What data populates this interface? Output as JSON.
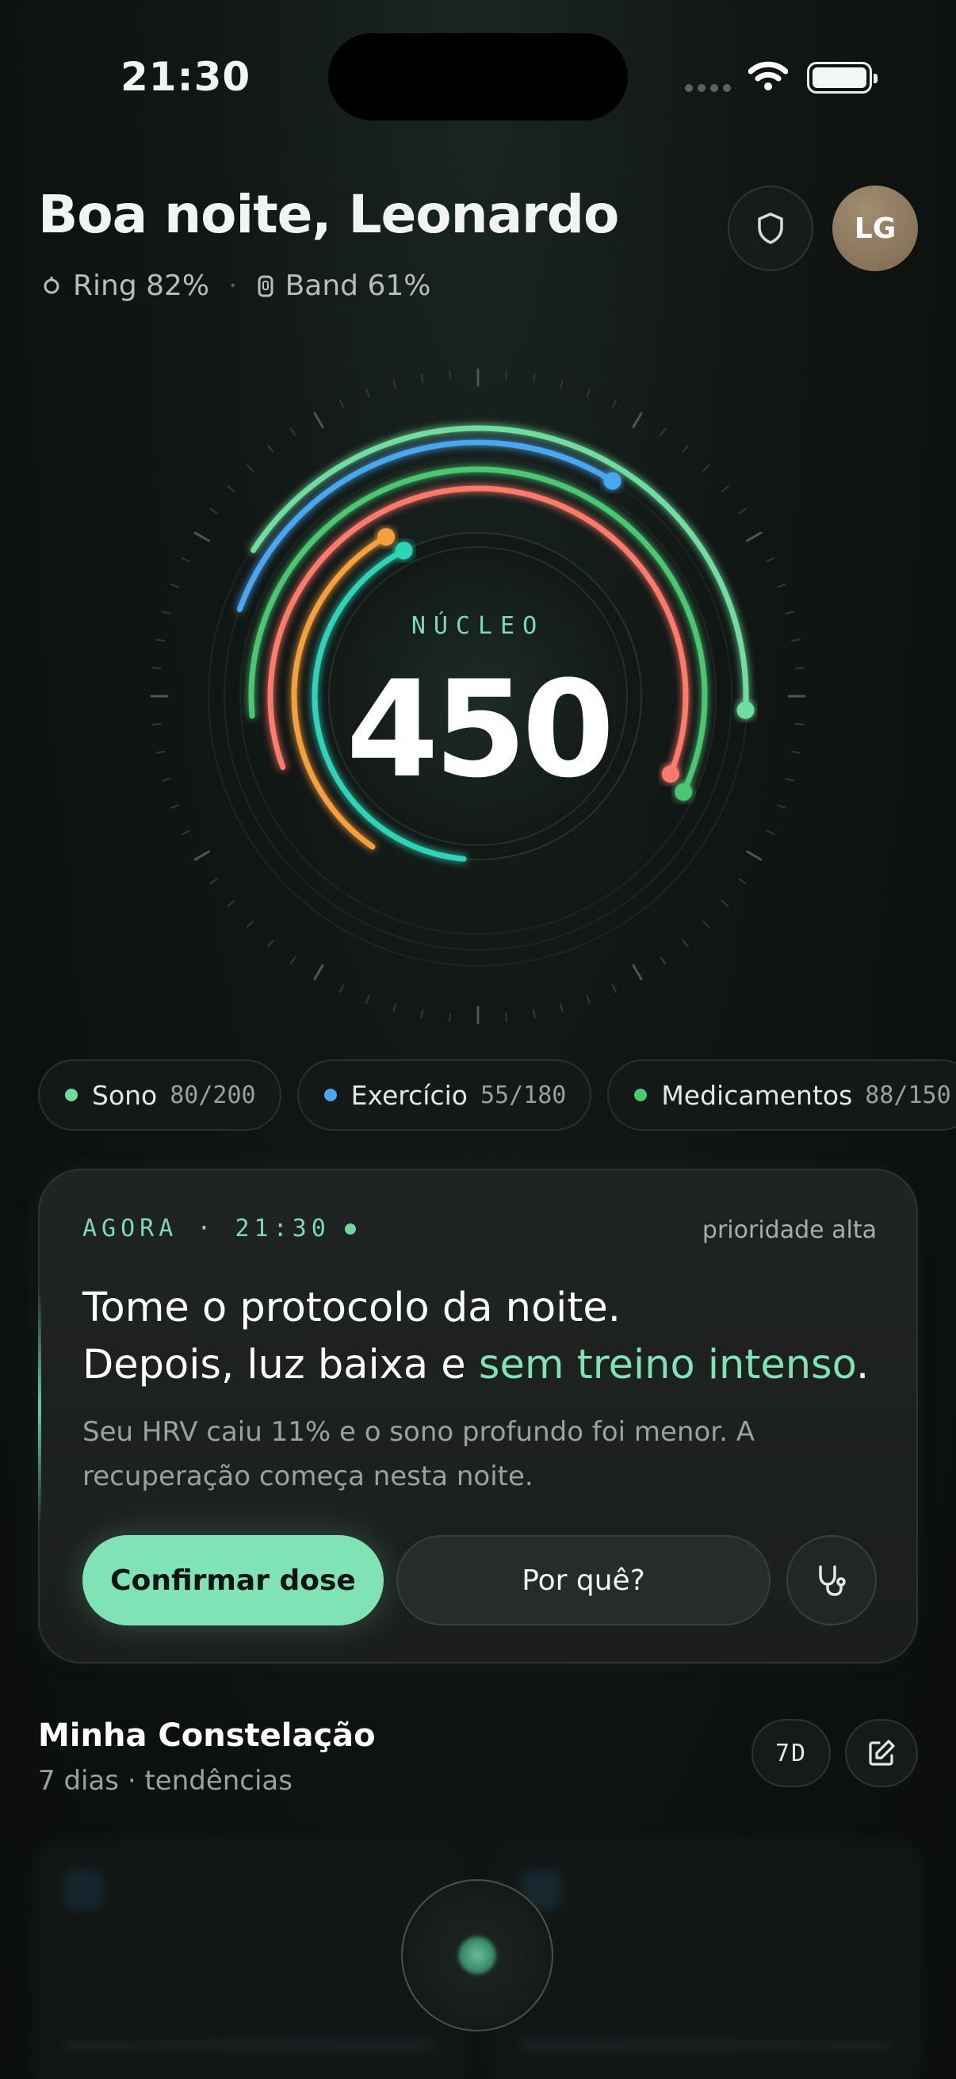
{
  "status_bar": {
    "time": "21:30"
  },
  "header": {
    "greeting": "Boa noite, Leonardo",
    "devices": [
      {
        "icon": "ring-icon",
        "label": "Ring 82%"
      },
      {
        "icon": "band-icon",
        "label": "Band 61%"
      }
    ],
    "separator": "·",
    "avatar_initials": "LG"
  },
  "gauge": {
    "label": "NÚCLEO",
    "value": "450",
    "arcs": [
      {
        "name": "outer-green",
        "color": "#6fdc9f",
        "fraction": 0.54
      },
      {
        "name": "blue",
        "color": "#4aa7ef",
        "fraction": 0.82
      },
      {
        "name": "green",
        "color": "#4cc773",
        "fraction": 0.58
      },
      {
        "name": "coral",
        "color": "#ff7a6b",
        "fraction": 0.62
      },
      {
        "name": "orange",
        "color": "#f6a03c",
        "fraction": 0.22
      },
      {
        "name": "teal",
        "color": "#2fd3b8",
        "fraction": 0.4
      }
    ]
  },
  "chips": [
    {
      "label": "Sono",
      "value": "80/200",
      "color": "#6fdc9f"
    },
    {
      "label": "Exercício",
      "value": "55/180",
      "color": "#4aa7ef"
    },
    {
      "label": "Medicamentos",
      "value": "88/150",
      "color": "#4cc773"
    }
  ],
  "card": {
    "now_label": "AGORA · 21:30",
    "priority": "prioridade alta",
    "title_line1": "Tome o protocolo da noite.",
    "title_line2_prefix": "Depois, luz baixa e ",
    "title_line2_highlight": "sem treino intenso",
    "title_line2_suffix": ".",
    "description": "Seu HRV caiu 11% e o sono profundo foi menor. A recuperação começa nesta noite.",
    "confirm_label": "Confirmar dose",
    "why_label": "Por quê?"
  },
  "constellation": {
    "title": "Minha Constelação",
    "subtitle": "7 dias · tendências",
    "period_label": "7D"
  },
  "colors": {
    "accent": "#7fe3b6",
    "background": "#0d1110"
  }
}
